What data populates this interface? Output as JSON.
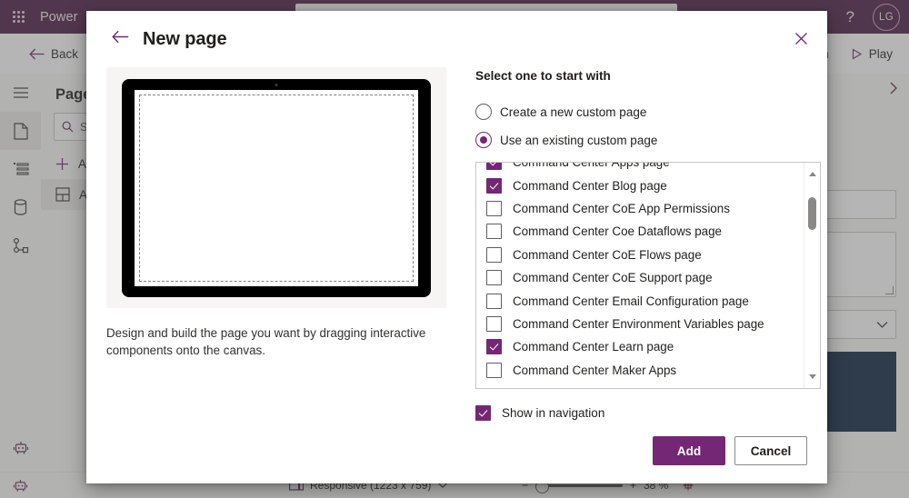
{
  "background": {
    "topbar": {
      "waffle_icon": "app-launcher-icon",
      "brand": "Power",
      "help_icon": "?",
      "avatar_initials": "LG"
    },
    "commandbar": {
      "back_label": "Back",
      "publish_label": "ish",
      "play_label": "Play"
    },
    "tree": {
      "title": "Page",
      "search_placeholder": "S",
      "add_label": "A",
      "selected_item_label": "Ap"
    },
    "statusbar": {
      "responsive_label": "Responsive (1223 x 759)",
      "zoom_minus": "−",
      "zoom_plus": "+",
      "zoom_percent": "38 %"
    }
  },
  "dialog": {
    "title": "New page",
    "back_icon": "arrow-left-icon",
    "close_icon": "close-icon",
    "preview": {
      "description": "Design and build the page you want by dragging interactive components onto the canvas."
    },
    "options": {
      "heading": "Select one to start with",
      "radios": [
        {
          "label": "Create a new custom page",
          "checked": false
        },
        {
          "label": "Use an existing custom page",
          "checked": true
        }
      ],
      "list": [
        {
          "label": "Command Center Apps page",
          "checked": true
        },
        {
          "label": "Command Center Blog page",
          "checked": true
        },
        {
          "label": "Command Center CoE App Permissions",
          "checked": false
        },
        {
          "label": "Command Center Coe Dataflows page",
          "checked": false
        },
        {
          "label": "Command Center CoE Flows page",
          "checked": false
        },
        {
          "label": "Command Center CoE Support page",
          "checked": false
        },
        {
          "label": "Command Center Email Configuration page",
          "checked": false
        },
        {
          "label": "Command Center Environment Variables page",
          "checked": false
        },
        {
          "label": "Command Center Learn page",
          "checked": true
        },
        {
          "label": "Command Center Maker Apps",
          "checked": false
        }
      ],
      "show_in_navigation": {
        "label": "Show in navigation",
        "checked": true
      }
    },
    "footer": {
      "primary_label": "Add",
      "secondary_label": "Cancel"
    }
  },
  "colors": {
    "brand_purple": "#742774",
    "header_purple": "#4a1b42",
    "accent_navy": "#0c2340"
  }
}
